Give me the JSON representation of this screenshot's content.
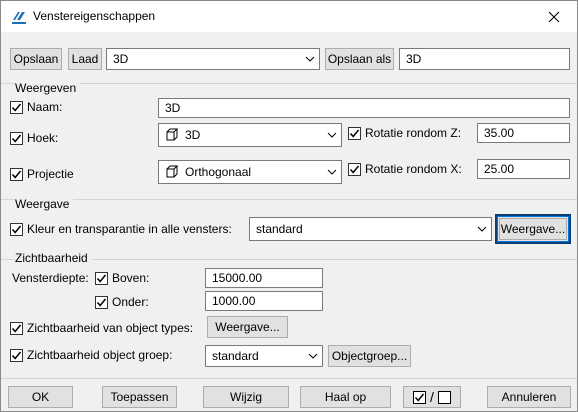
{
  "window": {
    "title": "Venstereigenschappen"
  },
  "top_bar": {
    "save_label": "Opslaan",
    "load_label": "Laad",
    "preset_value": "3D",
    "save_as_label": "Opslaan als",
    "save_as_value": "3D"
  },
  "weergeven": {
    "group_label": "Weergeven",
    "naam_label": "Naam:",
    "naam_checked": true,
    "naam_value": "3D",
    "hoek_label": "Hoek:",
    "hoek_checked": true,
    "hoek_value": "3D",
    "rot_z_label": "Rotatie rondom Z:",
    "rot_z_checked": true,
    "rot_z_value": "35.00",
    "projectie_label": "Projectie",
    "projectie_checked": true,
    "projectie_value": "Orthogonaal",
    "rot_x_label": "Rotatie rondom X:",
    "rot_x_checked": true,
    "rot_x_value": "25.00"
  },
  "weergave": {
    "group_label": "Weergave",
    "kleur_label": "Kleur en transparantie in alle vensters:",
    "kleur_checked": true,
    "kleur_value": "standard",
    "button_label": "Weergave..."
  },
  "zichtbaarheid": {
    "group_label": "Zichtbaarheid",
    "diepte_label": "Vensterdiepte:",
    "boven_label": "Boven:",
    "boven_checked": true,
    "boven_value": "15000.00",
    "onder_label": "Onder:",
    "onder_checked": true,
    "onder_value": "1000.00",
    "types_label": "Zichtbaarheid van object types:",
    "types_checked": true,
    "types_button": "Weergave...",
    "groep_label": "Zichtbaarheid object groep:",
    "groep_checked": true,
    "groep_value": "standard",
    "groep_button": "Objectgroep..."
  },
  "bottom": {
    "ok_label": "OK",
    "apply_label": "Toepassen",
    "modify_label": "Wijzig",
    "get_label": "Haal op",
    "cancel_label": "Annuleren"
  }
}
